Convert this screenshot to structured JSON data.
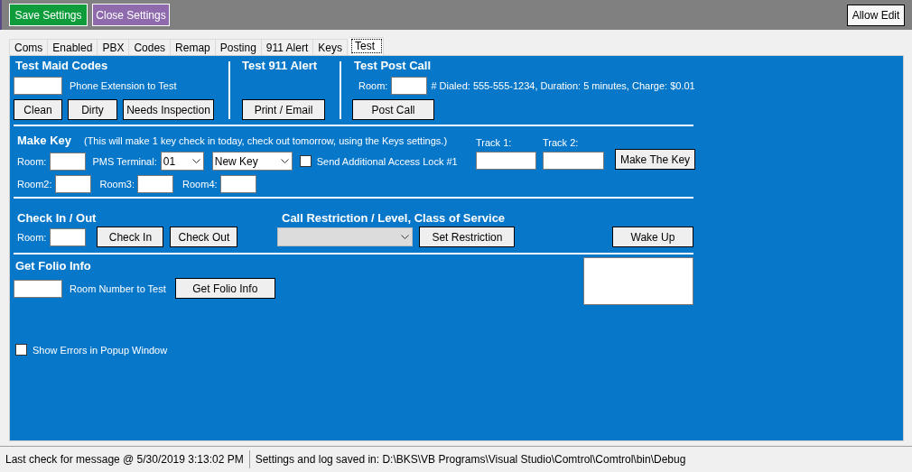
{
  "toolbar": {
    "buttons": [
      {
        "label": "Save Settings",
        "color": "#0f9d3b"
      },
      {
        "label": "Close Settings",
        "color": "#8f6bae"
      }
    ],
    "allow_edit_button": "Allow Edit"
  },
  "tabs": [
    {
      "label": "Coms",
      "selected": false
    },
    {
      "label": "Enabled",
      "selected": false
    },
    {
      "label": "PBX",
      "selected": false
    },
    {
      "label": "Codes",
      "selected": false
    },
    {
      "label": "Remap",
      "selected": false
    },
    {
      "label": "Posting",
      "selected": false
    },
    {
      "label": "911 Alert",
      "selected": false
    },
    {
      "label": "Keys",
      "selected": false
    },
    {
      "label": "Test",
      "selected": true
    }
  ],
  "maid_codes": {
    "title": "Test Maid Codes",
    "extension_label": "Phone Extension to Test",
    "buttons": [
      "Clean",
      "Dirty",
      "Needs Inspection"
    ]
  },
  "alert_911": {
    "title": "Test 911 Alert",
    "button": "Print / Email"
  },
  "post_call": {
    "title": "Test Post Call",
    "room_label": "Room:",
    "details": "# Dialed: 555-555-1234, Duration: 5 minutes, Charge: $0.01",
    "button": "Post Call"
  },
  "make_key": {
    "title": "Make Key",
    "note": "(This will make 1 key check in today, check out tomorrow, using the Keys settings.)",
    "room_label": "Room:",
    "pms_terminal_label": "PMS Terminal:",
    "terminal": "01",
    "key_type": "New Key",
    "send_lock": {
      "label": "Send Additional Access Lock #1",
      "checked": false
    },
    "room2_label": "Room2:",
    "room3_label": "Room3:",
    "room4_label": "Room4:",
    "track1_label": "Track 1:",
    "track2_label": "Track 2:",
    "button": "Make The Key"
  },
  "check_in_out": {
    "title": "Check In / Out",
    "room_label": "Room:",
    "buttons": [
      "Check In",
      "Check Out"
    ]
  },
  "call_restriction": {
    "title": "Call Restriction / Level, Class of Service",
    "dropdown": {
      "disabled": true
    },
    "button": "Set Restriction"
  },
  "wake_up_button": "Wake Up",
  "folio": {
    "title": "Get Folio Info",
    "room_label": "Room Number to Test",
    "button": "Get Folio Info"
  },
  "show_errors": {
    "label": "Show Errors in Popup Window",
    "checked": false
  },
  "status_bar": [
    "Last check for message @ 5/30/2019 3:13:02 PM",
    "Settings and log saved in: D:\\BKS\\VB Programs\\Visual Studio\\Comtrol\\Comtrol\\bin\\Debug"
  ]
}
